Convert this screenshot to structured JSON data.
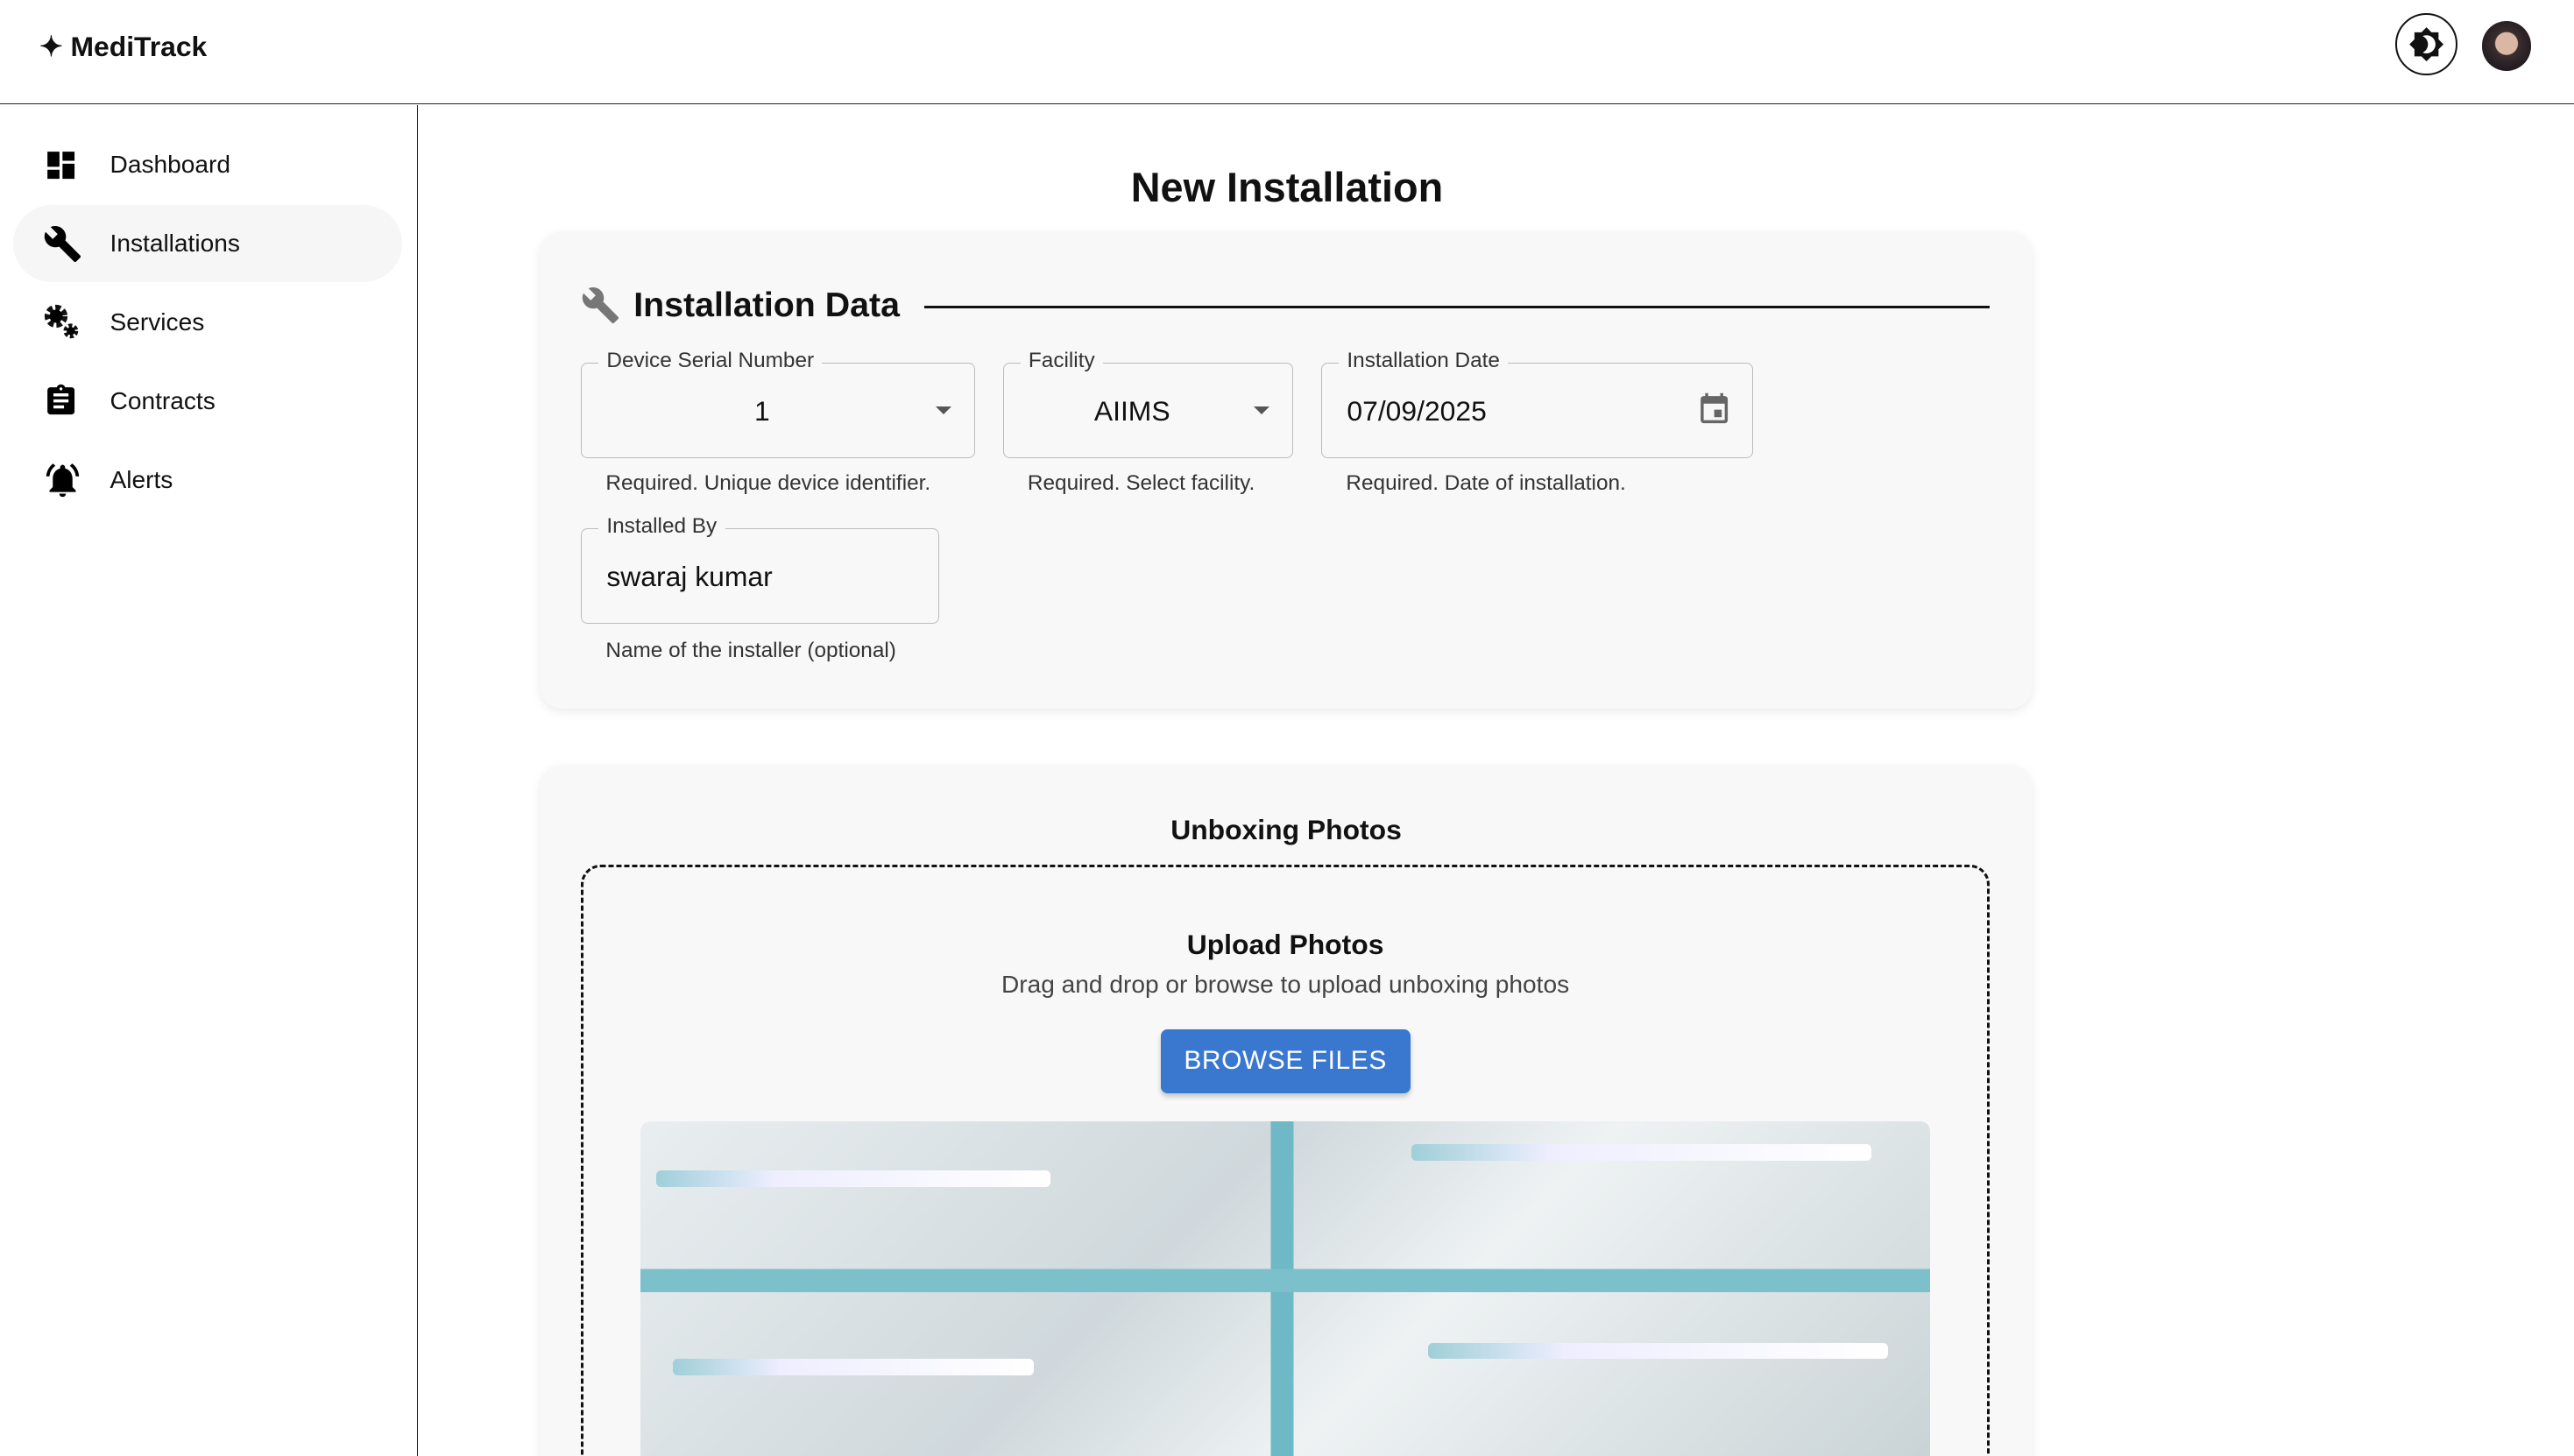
{
  "app": {
    "name": "MediTrack",
    "logo_glyph": "✦"
  },
  "header": {
    "theme_toggle_icon": "brightness-icon",
    "avatar": "user-avatar"
  },
  "sidebar": {
    "items": [
      {
        "label": "Dashboard",
        "icon": "dashboard-icon"
      },
      {
        "label": "Installations",
        "icon": "wrench-icon",
        "active": true
      },
      {
        "label": "Services",
        "icon": "gears-icon"
      },
      {
        "label": "Contracts",
        "icon": "clipboard-icon"
      },
      {
        "label": "Alerts",
        "icon": "bell-icon"
      }
    ]
  },
  "page": {
    "title": "New Installation"
  },
  "installation_data": {
    "title": "Installation Data",
    "serial": {
      "label": "Device Serial Number",
      "value": "1",
      "help": "Required. Unique device identifier."
    },
    "facility": {
      "label": "Facility",
      "value": "AIIMS",
      "help": "Required. Select facility."
    },
    "date": {
      "label": "Installation Date",
      "value": "07/09/2025",
      "help": "Required. Date of installation."
    },
    "installer": {
      "label": "Installed By",
      "value": "swaraj kumar",
      "help": "Name of the installer (optional)"
    }
  },
  "photos": {
    "title": "Unboxing Photos",
    "upload_title": "Upload Photos",
    "upload_subtitle": "Drag and drop or browse to upload unboxing photos",
    "browse_label": "BROWSE FILES"
  },
  "colors": {
    "accent": "#3a78d0"
  }
}
